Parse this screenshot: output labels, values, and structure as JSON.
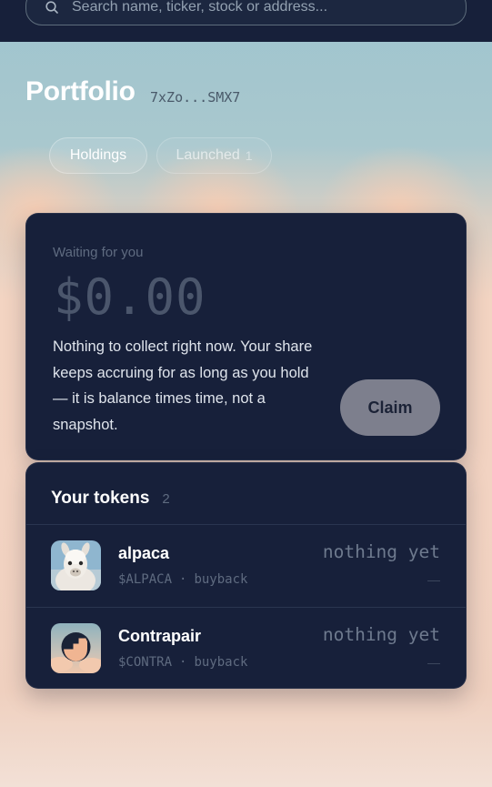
{
  "search": {
    "placeholder": "Search name, ticker, stock or address..."
  },
  "header": {
    "title": "Portfolio",
    "address": "7xZo...SMX7"
  },
  "tabs": [
    {
      "label": "Holdings",
      "active": true
    },
    {
      "label": "Launched",
      "count": "1",
      "active": false
    }
  ],
  "claim": {
    "label": "Waiting for you",
    "amount": "$0.00",
    "description": "Nothing to collect right now. Your share keeps accruing for as long as you hold — it is balance times time, not a snapshot.",
    "button_label": "Claim"
  },
  "tokens": {
    "title": "Your tokens",
    "count": "2",
    "items": [
      {
        "name": "alpaca",
        "ticker": "$ALPACA",
        "separator": "·",
        "type": "buyback",
        "status": "nothing yet",
        "value": "—",
        "icon": "alpaca-avatar"
      },
      {
        "name": "Contrapair",
        "ticker": "$CONTRA",
        "separator": "·",
        "type": "buyback",
        "status": "nothing yet",
        "value": "—",
        "icon": "contrapair-avatar"
      }
    ]
  },
  "colors": {
    "card_bg": "#17203a",
    "topbar_bg": "#17203a",
    "button_bg": "#7d7f8d"
  }
}
